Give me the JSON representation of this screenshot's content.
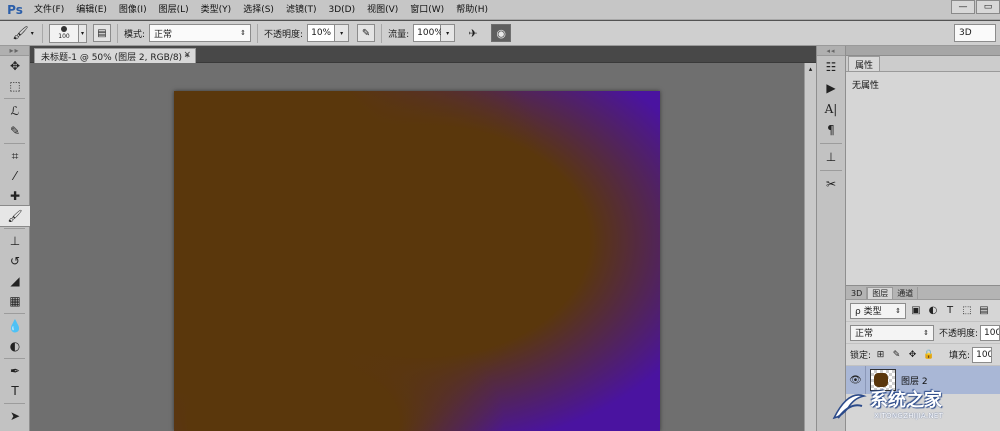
{
  "app": {
    "logo": "Ps"
  },
  "menu": {
    "items": [
      "文件(F)",
      "编辑(E)",
      "图像(I)",
      "图层(L)",
      "类型(Y)",
      "选择(S)",
      "滤镜(T)",
      "3D(D)",
      "视图(V)",
      "窗口(W)",
      "帮助(H)"
    ]
  },
  "window_controls": {
    "minimize": "—",
    "maximize": "▭"
  },
  "options": {
    "brush_size": "100",
    "mode_label": "模式:",
    "mode_value": "正常",
    "opacity_label": "不透明度:",
    "opacity_value": "10%",
    "flow_label": "流量:",
    "flow_value": "100%",
    "workspace_value": "3D"
  },
  "document": {
    "tab_title": "未标题-1 @ 50% (图层 2, RGB/8) *",
    "close": "×"
  },
  "tools": [
    {
      "name": "move-tool",
      "glyph": "✥"
    },
    {
      "name": "marquee-tool",
      "glyph": "⬚"
    },
    {
      "name": "lasso-tool",
      "glyph": "ℒ"
    },
    {
      "name": "quick-select-tool",
      "glyph": "✎"
    },
    {
      "name": "crop-tool",
      "glyph": "⌗"
    },
    {
      "name": "eyedropper-tool",
      "glyph": "⁄"
    },
    {
      "name": "healing-brush-tool",
      "glyph": "✚"
    },
    {
      "name": "brush-tool",
      "glyph": "🖌"
    },
    {
      "name": "clone-stamp-tool",
      "glyph": "⊥"
    },
    {
      "name": "history-brush-tool",
      "glyph": "↺"
    },
    {
      "name": "eraser-tool",
      "glyph": "◢"
    },
    {
      "name": "gradient-tool",
      "glyph": "▦"
    },
    {
      "name": "blur-tool",
      "glyph": "💧"
    },
    {
      "name": "dodge-tool",
      "glyph": "◐"
    },
    {
      "name": "pen-tool",
      "glyph": "✒"
    },
    {
      "name": "type-tool",
      "glyph": "T"
    },
    {
      "name": "path-select-tool",
      "glyph": "➤"
    },
    {
      "name": "shape-tool",
      "glyph": "⬡"
    }
  ],
  "strip_icons": [
    {
      "name": "history-icon",
      "glyph": "☷"
    },
    {
      "name": "actions-icon",
      "glyph": "▶"
    },
    {
      "name": "character-icon",
      "glyph": "A|"
    },
    {
      "name": "paragraph-icon",
      "glyph": "¶"
    },
    {
      "name": "clone-source-icon",
      "glyph": "⊥"
    },
    {
      "name": "tool-presets-icon",
      "glyph": "✂"
    }
  ],
  "properties": {
    "tab": "属性",
    "body": "无属性"
  },
  "layers": {
    "tabs": [
      "3D",
      "图层",
      "通道"
    ],
    "filter_value": "ρ 类型",
    "blend_value": "正常",
    "opacity_label": "不透明度:",
    "opacity_value": "100",
    "lock_label": "锁定:",
    "fill_label": "填充:",
    "fill_value": "100",
    "layer_name": "图层 2"
  },
  "watermark": {
    "title": "系统之家",
    "subtitle": "XITONGZHIJIA.NET"
  }
}
